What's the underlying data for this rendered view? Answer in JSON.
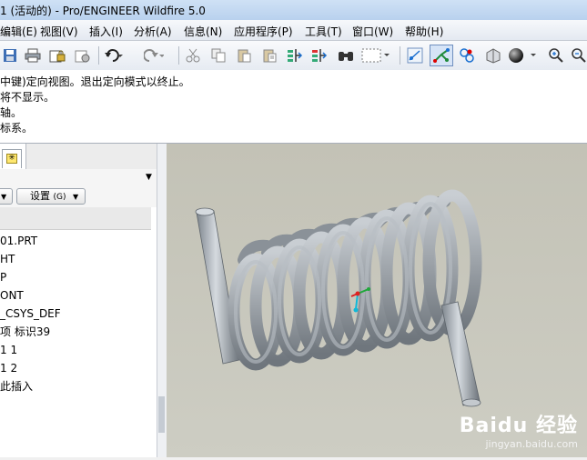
{
  "window": {
    "title": "1 (活动的) - Pro/ENGINEER Wildfire 5.0"
  },
  "menu": [
    {
      "label": "编辑(E)",
      "key": "edit"
    },
    {
      "label": "视图(V)",
      "key": "view"
    },
    {
      "label": "插入(I)",
      "key": "insert"
    },
    {
      "label": "分析(A)",
      "key": "analysis"
    },
    {
      "label": "信息(N)",
      "key": "info"
    },
    {
      "label": "应用程序(P)",
      "key": "applications"
    },
    {
      "label": "工具(T)",
      "key": "tools"
    },
    {
      "label": "窗口(W)",
      "key": "window"
    },
    {
      "label": "帮助(H)",
      "key": "help"
    }
  ],
  "toolbar": {
    "icons": [
      "save-icon",
      "print-icon",
      "lock-icon",
      "lock-alt-icon",
      "undo-icon",
      "redo-icon",
      "cut-icon",
      "copy-icon",
      "paste-icon",
      "paste-special-icon",
      "regenerate-icon",
      "regenerate-manager-icon",
      "find-icon",
      "selection-box-icon",
      "spin-center-icon",
      "orient-mode-icon",
      "datum-display-icon",
      "saved-views-icon",
      "shading-icon",
      "zoom-in-icon",
      "zoom-out-icon"
    ]
  },
  "messages": [
    "中键)定向视图。退出定向模式以终止。",
    "将不显示。",
    "轴。",
    "标系。"
  ],
  "left_panel": {
    "settings_label": "设置",
    "settings_key": "(G)",
    "tree_items": [
      "01.PRT",
      "HT",
      "P",
      "ONT",
      "_CSYS_DEF",
      "项 标识39",
      "1 1",
      "1 2",
      "此插入"
    ]
  },
  "watermark": {
    "brand": "Baidu 经验",
    "url": "jingyan.baidu.com"
  },
  "colors": {
    "viewport_bg": "#c6c5ba",
    "spring": "#a6adb5",
    "title_bar": "#c3d8f2"
  }
}
